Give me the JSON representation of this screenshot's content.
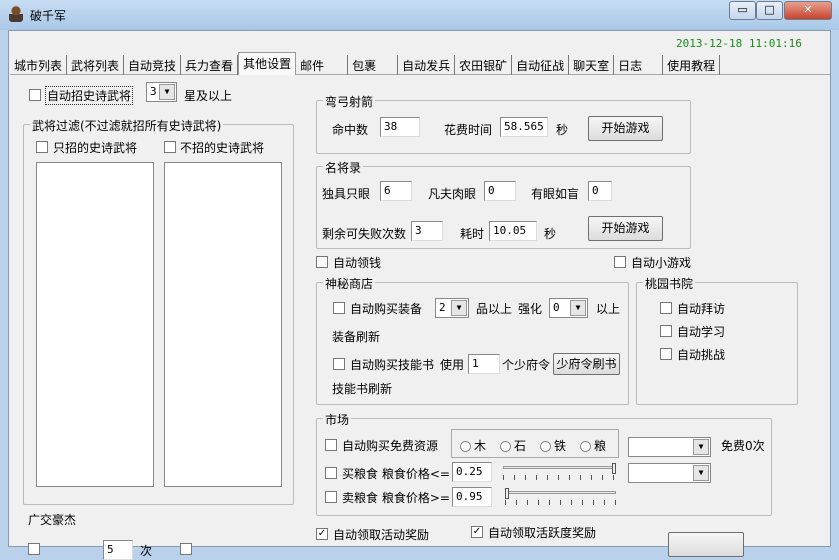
{
  "window": {
    "title": "破千军",
    "minimize": "▭",
    "maximize": "□",
    "close": "✕"
  },
  "datetime": "2013-12-18 11:01:16",
  "tabs": [
    "城市列表",
    "武将列表",
    "自动竞技",
    "兵力查看",
    "其他设置",
    "邮件",
    "包裹",
    "自动发兵",
    "农田银矿",
    "自动征战",
    "聊天室",
    "日志",
    "使用教程"
  ],
  "active_tab": "其他设置",
  "epic": {
    "auto_label": "自动招史诗武将",
    "stars": "3",
    "stars_suffix": "星及以上",
    "filter_title": "武将过滤(不过滤就招所有史诗武将)",
    "only_label": "只招的史诗武将",
    "exclude_label": "不招的史诗武将"
  },
  "archery": {
    "title": "弯弓射箭",
    "hits_label": "命中数",
    "hits": "38",
    "time_label": "花费时间",
    "time": "58.565",
    "sec": "秒",
    "start": "开始游戏"
  },
  "famous": {
    "title": "名将录",
    "a_label": "独具只眼",
    "a": "6",
    "b_label": "凡夫肉眼",
    "b": "0",
    "c_label": "有眼如盲",
    "c": "0",
    "fail_label": "剩余可失败次数",
    "fail": "3",
    "time_label": "耗时",
    "time": "10.05",
    "sec": "秒",
    "start": "开始游戏"
  },
  "auto_money": "自动领钱",
  "auto_minigame": "自动小游戏",
  "shop": {
    "title": "神秘商店",
    "buy_equip": "自动购买装备",
    "quality": "2",
    "quality_suffix": "品以上",
    "enhance_label": "强化",
    "enhance": "0",
    "enhance_suffix": "以上",
    "equip_refresh": "装备刷新",
    "buy_book": "自动购买技能书",
    "use_label": "使用",
    "tokens": "1",
    "tokens_suffix": "个少府令",
    "refresh_btn": "少府令刷书",
    "book_refresh": "技能书刷新"
  },
  "academy": {
    "title": "桃园书院",
    "items": [
      "自动拜访",
      "自动学习",
      "自动挑战"
    ]
  },
  "market": {
    "title": "市场",
    "free_label": "自动购买免费资源",
    "resources": [
      "木",
      "石",
      "铁",
      "粮"
    ],
    "free_count": "免费0次",
    "buy_label": "买粮食 粮食价格<=",
    "buy_price": "0.25",
    "buy_slider": 1.0,
    "sell_label": "卖粮食 粮食价格>=",
    "sell_price": "0.95",
    "sell_slider": 0.0
  },
  "hero_label": "广交豪杰",
  "rewards": {
    "activity": "自动领取活动奖励",
    "activity_checked": true,
    "liveness": "自动领取活跃度奖励",
    "liveness_checked": true
  },
  "bottom": {
    "count": "5",
    "count_suffix": "次"
  }
}
